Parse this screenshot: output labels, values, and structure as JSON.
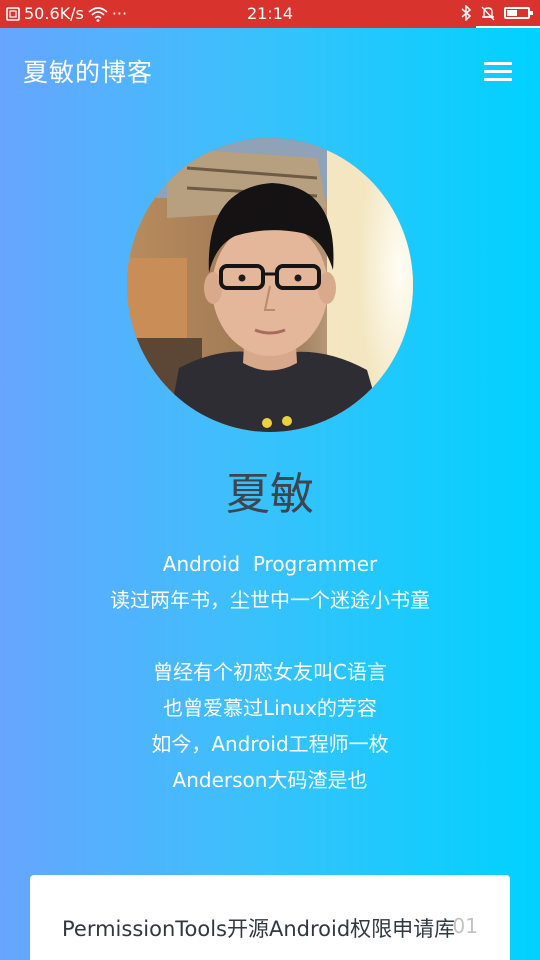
{
  "status_bar": {
    "speed": "50.6K/s",
    "dots": "···",
    "time": "21:14"
  },
  "header": {
    "title": "夏敏的博客"
  },
  "profile": {
    "name": "夏敏",
    "bio_lines_1": [
      "Android  Programmer",
      "读过两年书，尘世中一个迷途小书童"
    ],
    "bio_lines_2": [
      "曾经有个初恋女友叫C语言",
      "也曾爱慕过Linux的芳容",
      "如今，Android工程师一枚",
      "Anderson大码渣是也"
    ]
  },
  "card": {
    "title": "PermissionTools开源Android权限申请库",
    "number": "01"
  },
  "colors": {
    "status_bar": "#d9332d",
    "gradient_start": "#67a5ff",
    "gradient_end": "#00d2ff"
  }
}
